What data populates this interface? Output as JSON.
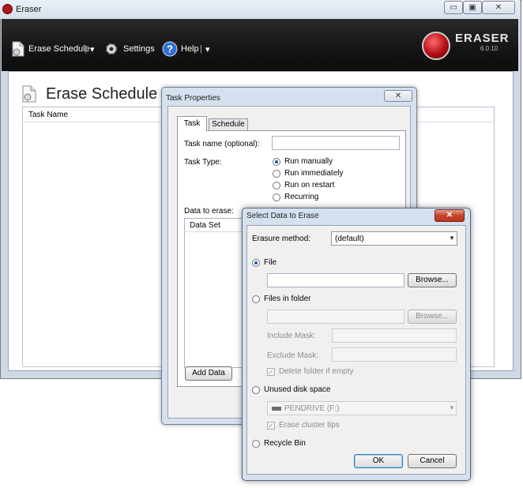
{
  "window": {
    "title": "Eraser",
    "minimize": "▭",
    "maximize": "▣",
    "close": "✕"
  },
  "toolbar": {
    "erase_schedule": "Erase Schedule",
    "settings": "Settings",
    "help": "Help",
    "separator": "|",
    "dropdown": "▾",
    "brand": "ERASER",
    "version": "6.0.10"
  },
  "main": {
    "page_title": "Erase Schedule",
    "column_task_name": "Task Name"
  },
  "task_properties": {
    "title": "Task Properties",
    "close": "✕",
    "tabs": [
      "Task",
      "Schedule"
    ],
    "task_name_label": "Task name (optional):",
    "task_name_value": "",
    "task_type_label": "Task Type:",
    "task_types": [
      "Run manually",
      "Run immediately",
      "Run on restart",
      "Recurring"
    ],
    "task_type_selected": "Run manually",
    "data_to_erase_label": "Data to erase:",
    "data_set_column": "Data Set",
    "add_data_button": "Add Data"
  },
  "select_data": {
    "title": "Select Data to Erase",
    "close": "✕",
    "erasure_method_label": "Erasure method:",
    "erasure_method_value": "(default)",
    "file_option": "File",
    "file_value": "",
    "browse_button": "Browse...",
    "files_in_folder_option": "Files in folder",
    "folder_value": "",
    "browse_folder_button": "Browse...",
    "include_mask_label": "Include Mask:",
    "exclude_mask_label": "Exclude Mask:",
    "delete_folder_label": "Delete folder if empty",
    "unused_disk_option": "Unused disk space",
    "drive_value": "PENDRIVE (F:)",
    "erase_cluster_label": "Erase cluster tips",
    "recycle_bin_option": "Recycle Bin",
    "ok_button": "OK",
    "cancel_button": "Cancel",
    "selected_option": "File"
  }
}
